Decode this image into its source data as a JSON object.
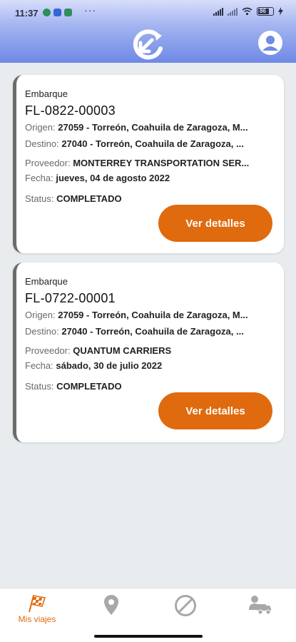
{
  "status_bar": {
    "time": "11:37",
    "more": "···",
    "battery": "86"
  },
  "header": {
    "logo_icon": "circular-arrow-logo-icon",
    "profile_icon": "user-profile-icon"
  },
  "shipments": [
    {
      "label": "Embarque",
      "id": "FL-0822-00003",
      "origin_label": "Origen:",
      "origin": "27059 - Torreón, Coahuila de Zaragoza, M...",
      "destination_label": "Destino:",
      "destination": "27040 - Torreón, Coahuila de Zaragoza, ...",
      "provider_label": "Proveedor:",
      "provider": "MONTERREY TRANSPORTATION SER...",
      "date_label": "Fecha:",
      "date": "jueves, 04 de agosto 2022",
      "status_label": "Status:",
      "status": "COMPLETADO",
      "button": "Ver detalles"
    },
    {
      "label": "Embarque",
      "id": "FL-0722-00001",
      "origin_label": "Origen:",
      "origin": "27059 - Torreón, Coahuila de Zaragoza, M...",
      "destination_label": "Destino:",
      "destination": "27040 - Torreón, Coahuila de Zaragoza, ...",
      "provider_label": "Proveedor:",
      "provider": "QUANTUM CARRIERS",
      "date_label": "Fecha:",
      "date": "sábado, 30 de julio 2022",
      "status_label": "Status:",
      "status": "COMPLETADO",
      "button": "Ver detalles"
    }
  ],
  "bottom_nav": {
    "items": [
      {
        "label": "Mis viajes",
        "icon": "checkered-flag-icon",
        "active": true
      },
      {
        "label": "",
        "icon": "location-pin-icon",
        "active": false
      },
      {
        "label": "",
        "icon": "no-entry-icon",
        "active": false
      },
      {
        "label": "",
        "icon": "truck-driver-icon",
        "active": false
      }
    ]
  },
  "colors": {
    "accent": "#e06a0e",
    "header_top": "#a3b4f0",
    "header_bottom": "#6f89e6",
    "background": "#e9ecee",
    "inactive_icon": "#a8a8a8"
  }
}
